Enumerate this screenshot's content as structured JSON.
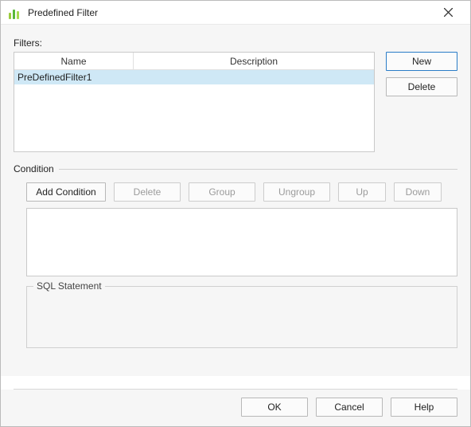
{
  "window": {
    "title": "Predefined Filter"
  },
  "filters": {
    "label": "Filters:",
    "headers": {
      "name": "Name",
      "description": "Description"
    },
    "rows": [
      {
        "name": "PreDefinedFilter1",
        "description": ""
      }
    ],
    "buttons": {
      "new_label": "New",
      "delete_label": "Delete"
    }
  },
  "condition": {
    "section_label": "Condition",
    "buttons": {
      "add": "Add Condition",
      "delete": "Delete",
      "group": "Group",
      "ungroup": "Ungroup",
      "up": "Up",
      "down": "Down"
    },
    "sql_label": "SQL Statement"
  },
  "footer": {
    "ok": "OK",
    "cancel": "Cancel",
    "help": "Help"
  }
}
